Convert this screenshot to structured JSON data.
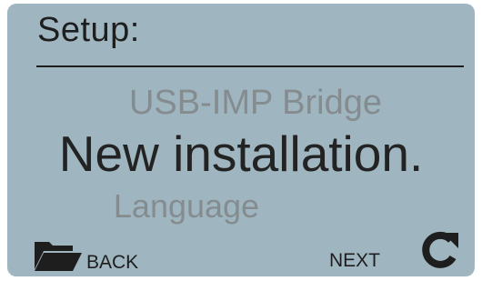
{
  "screen": {
    "title": "Setup:",
    "menu": {
      "previous_item": "USB-IMP Bridge",
      "selected_item": "New installation.",
      "next_item": "Language"
    },
    "softkeys": {
      "back_label": "BACK",
      "back_icon": "folder-icon",
      "next_label": "NEXT",
      "refresh_icon": "refresh-icon"
    },
    "colors": {
      "background": "#9fb6c0",
      "text_primary": "#1e1e1e",
      "text_dimmed": "#858c8f"
    }
  }
}
